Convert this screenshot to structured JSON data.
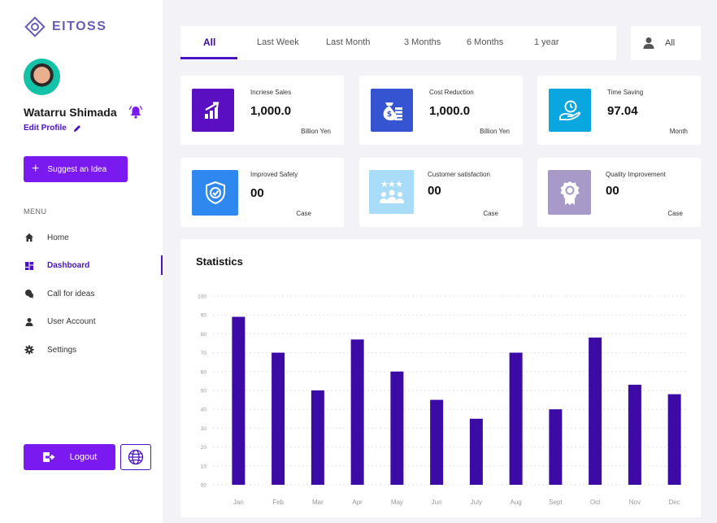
{
  "app": {
    "name": "EITOSS"
  },
  "colors": {
    "accent": "#7a1af0",
    "primary": "#4a12c4",
    "bar": "#3c0ba6"
  },
  "user": {
    "name": "Watarru Shimada",
    "edit_label": "Edit Profile"
  },
  "sidebar": {
    "suggest_label": "Suggest an Idea",
    "menu_label": "MENU",
    "items": [
      {
        "label": "Home",
        "icon": "home-icon",
        "active": false
      },
      {
        "label": "Dashboard",
        "icon": "dashboard-icon",
        "active": true
      },
      {
        "label": "Call for ideas",
        "icon": "chat-icon",
        "active": false
      },
      {
        "label": "User Account",
        "icon": "user-icon",
        "active": false
      },
      {
        "label": "Settings",
        "icon": "gear-icon",
        "active": false
      }
    ],
    "logout_label": "Logout"
  },
  "filters": {
    "tabs": [
      "All",
      "Last Week",
      "Last Month",
      "3 Months",
      "6 Months",
      "1 year"
    ],
    "selected": "All",
    "user_filter": "All"
  },
  "cards": [
    {
      "label": "Incriese Sales",
      "value": "1,000.0",
      "unit": "Billion Yen",
      "icon": "chart-up-icon",
      "color": "#5a10c2"
    },
    {
      "label": "Cost Reduction",
      "value": "1,000.0",
      "unit": "Billion Yen",
      "icon": "money-bag-icon",
      "color": "#3554d1"
    },
    {
      "label": "Time Saving",
      "value": "97.04",
      "unit": "Month",
      "icon": "time-hand-icon",
      "color": "#0aa6df"
    },
    {
      "label": "Improved Safety",
      "value": "00",
      "unit": "Case",
      "icon": "shield-check-icon",
      "color": "#2f88f0"
    },
    {
      "label": "Customer satisfaction",
      "value": "00",
      "unit": "Case",
      "icon": "rated-people-icon",
      "color": "#a9dcf8"
    },
    {
      "label": "Quality Improvement",
      "value": "00",
      "unit": "Case",
      "icon": "award-icon",
      "color": "#a79ac9"
    }
  ],
  "statistics": {
    "title": "Statistics"
  },
  "chart_data": {
    "type": "bar",
    "title": "Statistics",
    "categories": [
      "Jan",
      "Feb",
      "Mar",
      "Apr",
      "May",
      "Jun",
      "July",
      "Aug",
      "Sept",
      "Oct",
      "Nov",
      "Dec"
    ],
    "values": [
      89,
      70,
      50,
      77,
      60,
      45,
      35,
      70,
      40,
      78,
      53,
      48
    ],
    "ylim": [
      0,
      100
    ],
    "yticks": [
      "100",
      "90",
      "80",
      "70",
      "60",
      "50",
      "40",
      "30",
      "20",
      "10",
      "00"
    ],
    "grid": true,
    "legend": "none"
  }
}
